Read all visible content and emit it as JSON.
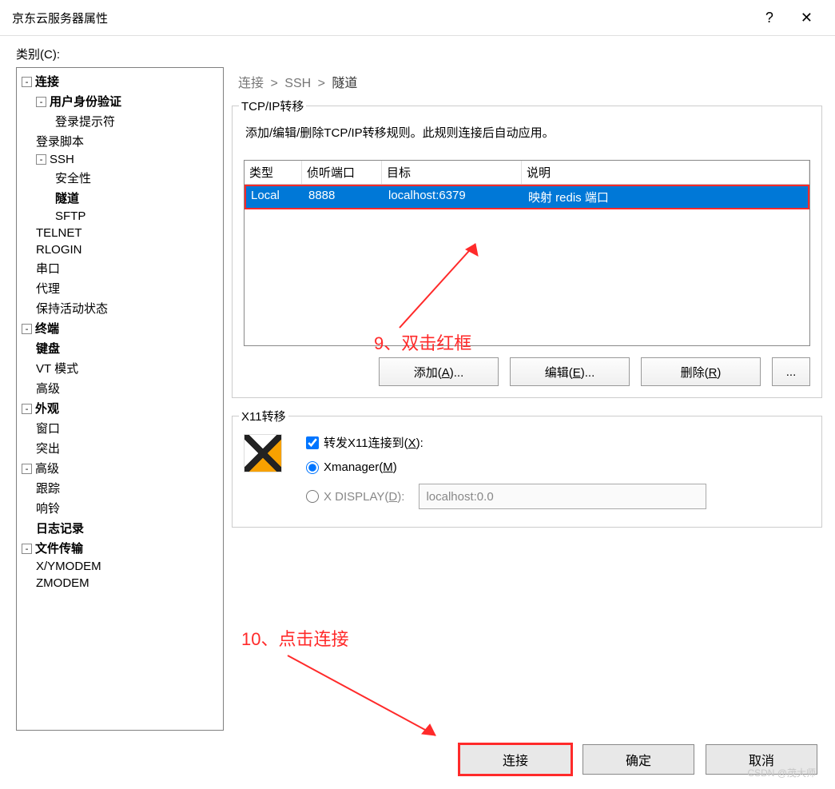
{
  "window": {
    "title": "京东云服务器属性"
  },
  "category_label": "类别(C):",
  "tree": {
    "connection": "连接",
    "auth": "用户身份验证",
    "login_prompt": "登录提示符",
    "login_script": "登录脚本",
    "ssh": "SSH",
    "security": "安全性",
    "tunnel": "隧道",
    "sftp": "SFTP",
    "telnet": "TELNET",
    "rlogin": "RLOGIN",
    "serial": "串口",
    "proxy": "代理",
    "keepalive": "保持活动状态",
    "terminal": "终端",
    "keyboard": "键盘",
    "vtmode": "VT 模式",
    "advanced_term": "高级",
    "appearance": "外观",
    "window": "窗口",
    "highlight": "突出",
    "advanced": "高级",
    "trace": "跟踪",
    "bell": "响铃",
    "log": "日志记录",
    "filetransfer": "文件传输",
    "xymodem": "X/YMODEM",
    "zmodem": "ZMODEM"
  },
  "breadcrumb": {
    "a": "连接",
    "b": "SSH",
    "c": "隧道"
  },
  "tcpip": {
    "legend": "TCP/IP转移",
    "instruction": "添加/编辑/删除TCP/IP转移规则。此规则连接后自动应用。",
    "headers": {
      "type": "类型",
      "port": "侦听端口",
      "target": "目标",
      "desc": "说明"
    },
    "row": {
      "type": "Local",
      "port": "8888",
      "target": "localhost:6379",
      "desc": "映射 redis 端口"
    },
    "buttons": {
      "add": "添加(A)...",
      "edit": "编辑(E)...",
      "remove": "删除(R)",
      "more": "..."
    }
  },
  "x11": {
    "legend": "X11转移",
    "forward_label": "转发X11连接到(X):",
    "xmanager_label": "Xmanager(M)",
    "xdisplay_label": "X DISPLAY(D):",
    "xdisplay_value": "localhost:0.0"
  },
  "annotations": {
    "a9": "9、双击红框",
    "a10": "10、点击连接"
  },
  "footer": {
    "connect": "连接",
    "ok": "确定",
    "cancel": "取消"
  },
  "watermark": "CSDN @茂大师"
}
